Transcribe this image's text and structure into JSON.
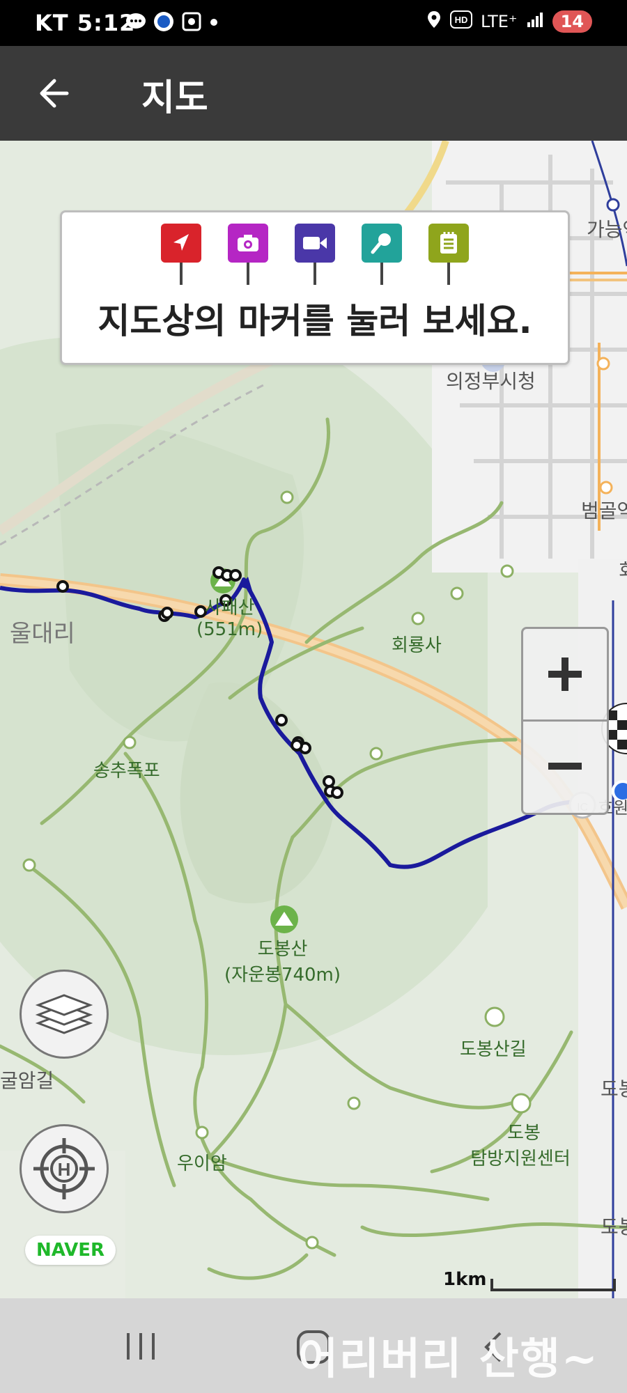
{
  "status_bar": {
    "carrier": "KT",
    "time": "5:12",
    "network": "LTE⁺",
    "battery": "14"
  },
  "header": {
    "title": "지도"
  },
  "info_box": {
    "message": "지도상의 마커를 눌러 보세요.",
    "markers": [
      {
        "name": "navigation-marker",
        "color": "#d9232b"
      },
      {
        "name": "camera-marker",
        "color": "#b526c4"
      },
      {
        "name": "video-marker",
        "color": "#4a37a8"
      },
      {
        "name": "microphone-marker",
        "color": "#22a39a"
      },
      {
        "name": "memo-marker",
        "color": "#8fa51c"
      }
    ]
  },
  "map": {
    "labels": {
      "peak_1_name": "사패산",
      "peak_1_height": "(551m)",
      "peak_2_name": "도봉산",
      "peak_2_height": "(자운봉740m)",
      "village": "울대리",
      "temple": "회룡사",
      "waterfall": "송추폭포",
      "city_hall": "의정부시청",
      "station_1": "가능역",
      "station_2": "범골역",
      "trail": "도봉산길",
      "center_1": "도봉",
      "center_2": "탐방지원센터",
      "rock": "우이암",
      "trail_left": "굴암길",
      "edge_right": "도봉",
      "edge_right_2": "도봉",
      "edge_right_3": "회",
      "ic": "호원"
    },
    "scale_label": "1km",
    "brand": "NAVER",
    "route_color": "#1a1a9c"
  },
  "controls": {
    "zoom_in": "+",
    "zoom_out": "−"
  },
  "watermark": "어리버리 산행~"
}
